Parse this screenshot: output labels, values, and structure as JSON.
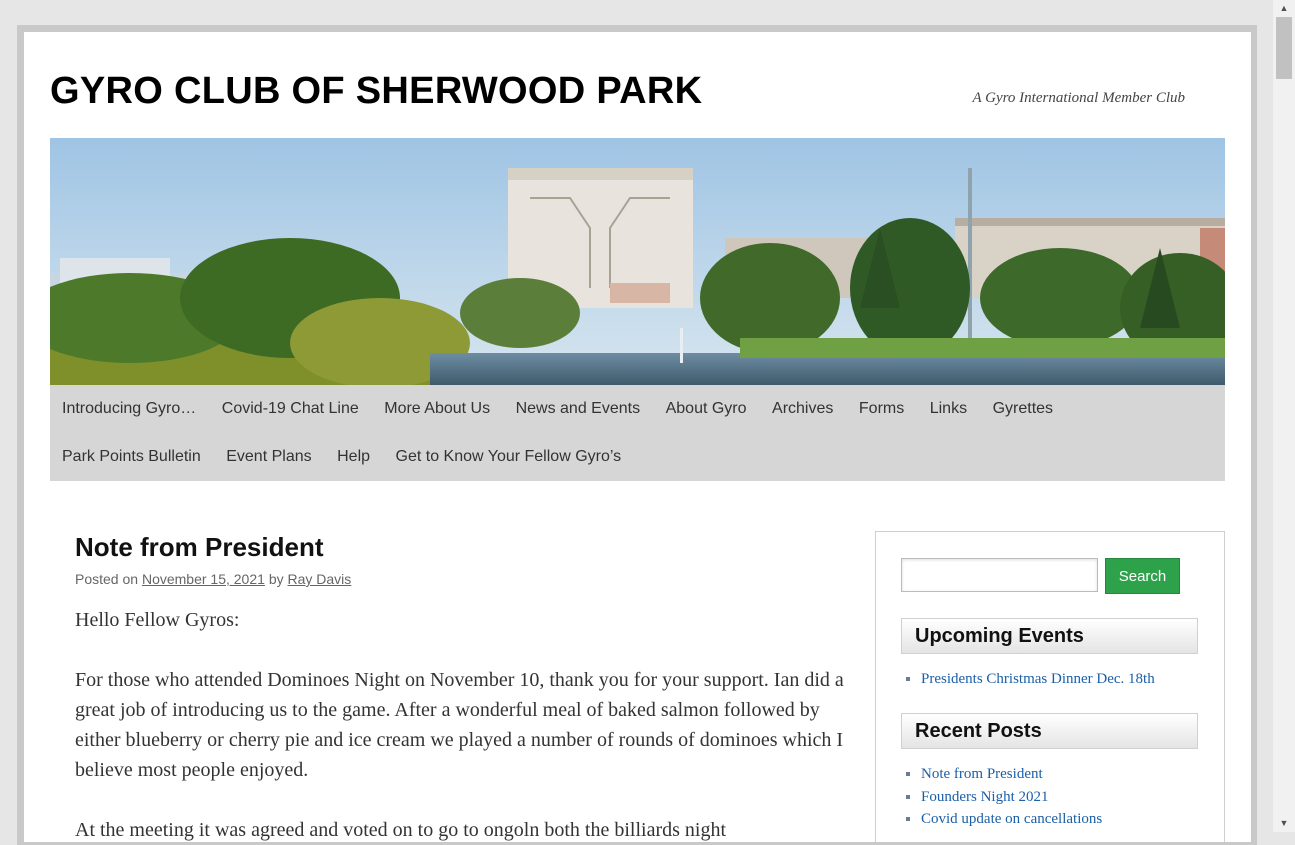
{
  "site": {
    "title": "GYRO CLUB OF SHERWOOD PARK",
    "description": "A Gyro International Member Club"
  },
  "nav": {
    "row1": [
      "Introducing Gyro…",
      "Covid-19 Chat Line",
      "More About Us",
      "News and Events",
      "About Gyro",
      "Archives",
      "Forms",
      "Links",
      "Gyrettes"
    ],
    "row2": [
      "Park Points Bulletin",
      "Event Plans",
      "Help",
      "Get to Know Your Fellow Gyro’s"
    ]
  },
  "post": {
    "title": "Note from President",
    "posted_on": "Posted on",
    "date": "November 15, 2021",
    "by": "by",
    "author": "Ray Davis",
    "paragraphs": [
      "Hello Fellow Gyros:",
      "For those who attended Dominoes Night on November 10, thank you for your support.  Ian did a great job of introducing us to the game.  After a wonderful meal of baked salmon followed by either blueberry or cherry pie and ice cream we played a number of rounds of dominoes which I believe most people enjoyed.",
      "At the meeting it was agreed and voted on to go to ongoln both the billiards night"
    ]
  },
  "sidebar": {
    "search_button": "Search",
    "search_placeholder": "",
    "upcoming_title": "Upcoming Events",
    "upcoming_items": [
      "Presidents Christmas Dinner Dec. 18th"
    ],
    "recent_title": "Recent Posts",
    "recent_items": [
      "Note from President",
      "Founders Night 2021",
      "Covid update on cancellations"
    ]
  },
  "colors": {
    "search_button": "#2ea24a",
    "nav_background": "#d6d6d6",
    "link": "#1b5fa8"
  },
  "icons": {
    "scroll_up": "up-arrow-icon",
    "scroll_down": "down-arrow-icon"
  }
}
